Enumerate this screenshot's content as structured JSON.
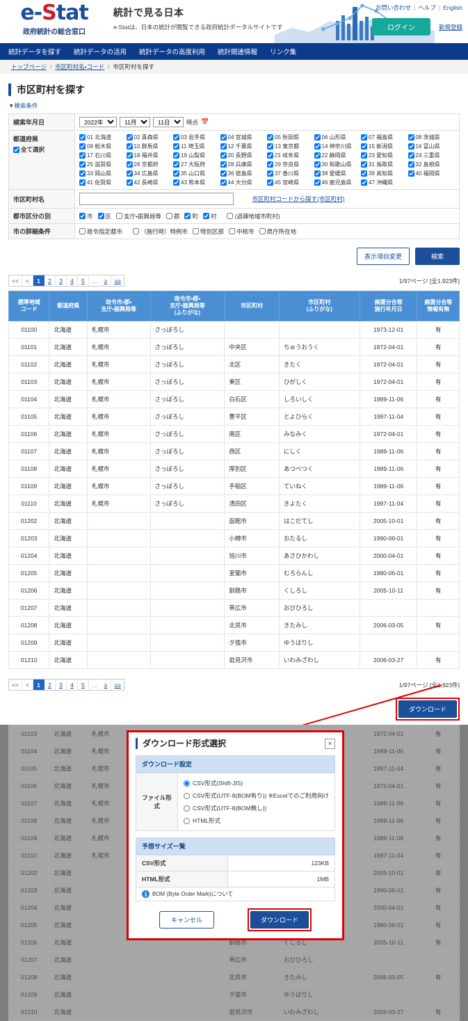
{
  "header": {
    "logo_text": "e-Stat",
    "logo_sub": "政府統計の総合窓口",
    "tagline_title": "統計で見る日本",
    "tagline_sub": "e-Statは、日本の統計が閲覧できる政府統計ポータルサイトです",
    "util_links": [
      "お問い合わせ",
      "ヘルプ",
      "English"
    ],
    "login_label": "ログイン",
    "register_label": "新規登録",
    "login_color": "#16a89a",
    "nav_color": "#0c3b8c"
  },
  "nav": {
    "items": [
      "統計データを探す",
      "統計データの活用",
      "統計データの高度利用",
      "統計関連情報",
      "リンク集"
    ]
  },
  "breadcrumb": {
    "items": [
      "トップページ",
      "市区町村名・コード",
      "市区町村を探す"
    ]
  },
  "page": {
    "title": "市区町村を探す",
    "cond_toggle": "▼検索条件"
  },
  "conditions": {
    "date_label": "検索年月日",
    "year": "2022年",
    "month": "11月",
    "day": "11日",
    "jiten": "時点",
    "calendar_icon": "calendar-icon",
    "pref_label": "都道府県",
    "select_all_label": "全て選択",
    "prefectures": [
      "01 北海道",
      "02 青森県",
      "03 岩手県",
      "04 宮城県",
      "05 秋田県",
      "06 山形県",
      "07 福島県",
      "08 茨城県",
      "09 栃木県",
      "10 群馬県",
      "11 埼玉県",
      "12 千葉県",
      "13 東京都",
      "14 神奈川県",
      "15 新潟県",
      "16 富山県",
      "17 石川県",
      "18 福井県",
      "19 山梨県",
      "20 長野県",
      "21 岐阜県",
      "22 静岡県",
      "23 愛知県",
      "24 三重県",
      "25 滋賀県",
      "26 京都府",
      "27 大阪府",
      "28 兵庫県",
      "29 奈良県",
      "30 和歌山県",
      "31 鳥取県",
      "32 島根県",
      "33 岡山県",
      "34 広島県",
      "35 山口県",
      "36 徳島県",
      "37 香川県",
      "38 愛媛県",
      "39 高知県",
      "40 福岡県",
      "41 佐賀県",
      "42 長崎県",
      "43 熊本県",
      "44 大分県",
      "45 宮崎県",
      "46 鹿児島県",
      "47 沖縄県"
    ],
    "city_name_label": "市区町村名",
    "city_name_value": "",
    "city_name_placeholder": "",
    "code_search_link": "市区町村コードから探す(市区町村)",
    "city_type_label": "都市区分の別",
    "city_types": [
      {
        "label": "市",
        "checked": true
      },
      {
        "label": "区",
        "checked": true
      },
      {
        "label": "支庁・振興局等",
        "checked": false
      },
      {
        "label": "郡",
        "checked": false
      },
      {
        "label": "町",
        "checked": true
      },
      {
        "label": "村",
        "checked": true
      },
      {
        "label": "(過疎地域市町村)",
        "checked": false
      }
    ],
    "city_detail_label": "市の詳細条件",
    "city_details": [
      {
        "label": "政令指定都市",
        "checked": false
      },
      {
        "label": "（施行時）特例市",
        "checked": false
      },
      {
        "label": "特別区部",
        "checked": false
      },
      {
        "label": "中核市",
        "checked": false
      },
      {
        "label": "県庁所在地",
        "checked": false
      }
    ]
  },
  "actions": {
    "display_change_label": "表示項目変更",
    "search_label": "検索"
  },
  "pagination": {
    "first": "<<",
    "prev": "<",
    "pages": [
      "1",
      "2",
      "3",
      "4",
      "5"
    ],
    "current": "1",
    "ellipsis": "…",
    "next": "≥",
    "last": "≥≥",
    "result_text": "1/97ページ [全1,923件]"
  },
  "results": {
    "columns": [
      "標準地域\nコード",
      "都道府県",
      "政令市・郡・\n支庁・振興局等",
      "政令市・郡・\n支庁・振興局等\n(ふりがな)",
      "市区町村",
      "市区町村\n(ふりがな)",
      "廃置分合等\n施行年月日",
      "廃置分合等\n情報有無"
    ],
    "rows": [
      [
        "01100",
        "北海道",
        "札幌市",
        "さっぽろし",
        "",
        "",
        "1973-12-01",
        "有"
      ],
      [
        "01101",
        "北海道",
        "札幌市",
        "さっぽろし",
        "中央区",
        "ちゅうおうく",
        "1972-04-01",
        "有"
      ],
      [
        "01102",
        "北海道",
        "札幌市",
        "さっぽろし",
        "北区",
        "きたく",
        "1972-04-01",
        "有"
      ],
      [
        "01103",
        "北海道",
        "札幌市",
        "さっぽろし",
        "東区",
        "ひがしく",
        "1972-04-01",
        "有"
      ],
      [
        "01104",
        "北海道",
        "札幌市",
        "さっぽろし",
        "白石区",
        "しろいしく",
        "1989-11-06",
        "有"
      ],
      [
        "01105",
        "北海道",
        "札幌市",
        "さっぽろし",
        "豊平区",
        "とよひらく",
        "1997-11-04",
        "有"
      ],
      [
        "01106",
        "北海道",
        "札幌市",
        "さっぽろし",
        "南区",
        "みなみく",
        "1972-04-01",
        "有"
      ],
      [
        "01107",
        "北海道",
        "札幌市",
        "さっぽろし",
        "西区",
        "にしく",
        "1989-11-06",
        "有"
      ],
      [
        "01108",
        "北海道",
        "札幌市",
        "さっぽろし",
        "厚別区",
        "あつべつく",
        "1989-11-06",
        "有"
      ],
      [
        "01109",
        "北海道",
        "札幌市",
        "さっぽろし",
        "手稲区",
        "ていねく",
        "1989-11-06",
        "有"
      ],
      [
        "01110",
        "北海道",
        "札幌市",
        "さっぽろし",
        "清田区",
        "きよたく",
        "1997-11-04",
        "有"
      ],
      [
        "01202",
        "北海道",
        "",
        "",
        "函館市",
        "はこだてし",
        "2005-10-01",
        "有"
      ],
      [
        "01203",
        "北海道",
        "",
        "",
        "小樽市",
        "おたるし",
        "1990-06-01",
        "有"
      ],
      [
        "01204",
        "北海道",
        "",
        "",
        "旭川市",
        "あさひかわし",
        "2000-04-01",
        "有"
      ],
      [
        "01205",
        "北海道",
        "",
        "",
        "室蘭市",
        "むろらんし",
        "1980-06-01",
        "有"
      ],
      [
        "01206",
        "北海道",
        "",
        "",
        "釧路市",
        "くしろし",
        "2005-10-11",
        "有"
      ],
      [
        "01207",
        "北海道",
        "",
        "",
        "帯広市",
        "おびひろし",
        "",
        ""
      ],
      [
        "01208",
        "北海道",
        "",
        "",
        "北見市",
        "きたみし",
        "2006-03-05",
        "有"
      ],
      [
        "01209",
        "北海道",
        "",
        "",
        "夕張市",
        "ゆうばりし",
        "",
        ""
      ],
      [
        "01210",
        "北海道",
        "",
        "",
        "岩見沢市",
        "いわみざわし",
        "2006-03-27",
        "有"
      ]
    ]
  },
  "download": {
    "button_label": "ダウンロード",
    "highlight_color": "#e00000"
  },
  "overlay_rows": [
    [
      "01103",
      "北海道",
      "札幌市",
      "さっぽろし",
      "東区",
      "ひがしく",
      "1972-04-01",
      "有"
    ],
    [
      "01104",
      "北海道",
      "札幌市",
      "さっぽろし",
      "白石区",
      "しろいしく",
      "1989-11-06",
      "有"
    ],
    [
      "01105",
      "北海道",
      "札幌市",
      "さっぽろし",
      "豊平区",
      "とよひらく",
      "1997-11-04",
      "有"
    ],
    [
      "01106",
      "北海道",
      "札幌市",
      "さっぽろし",
      "南区",
      "みなみく",
      "1972-04-01",
      "有"
    ],
    [
      "01107",
      "北海道",
      "札幌市",
      "さっぽろし",
      "西区",
      "にしく",
      "1989-11-06",
      "有"
    ],
    [
      "01108",
      "北海道",
      "札幌市",
      "さっぽろし",
      "厚別区",
      "あつべつく",
      "1989-11-06",
      "有"
    ],
    [
      "01109",
      "北海道",
      "札幌市",
      "さっぽろし",
      "手稲区",
      "ていねく",
      "1989-11-06",
      "有"
    ],
    [
      "01110",
      "北海道",
      "札幌市",
      "さっぽろし",
      "清田区",
      "きよたく",
      "1997-11-04",
      "有"
    ],
    [
      "01202",
      "北海道",
      "",
      "",
      "函館市",
      "はこだてし",
      "2005-10-01",
      "有"
    ],
    [
      "01203",
      "北海道",
      "",
      "",
      "小樽市",
      "おたるし",
      "1990-06-01",
      "有"
    ],
    [
      "01204",
      "北海道",
      "",
      "",
      "旭川市",
      "あさひかわし",
      "2000-04-01",
      "有"
    ],
    [
      "01205",
      "北海道",
      "",
      "",
      "室蘭市",
      "むろらんし",
      "1980-06-01",
      "有"
    ],
    [
      "01206",
      "北海道",
      "",
      "",
      "釧路市",
      "くしろし",
      "2005-10-11",
      "有"
    ],
    [
      "01207",
      "北海道",
      "",
      "",
      "帯広市",
      "おびひろし",
      "",
      ""
    ],
    [
      "01208",
      "北海道",
      "",
      "",
      "北見市",
      "きたみし",
      "2006-03-05",
      "有"
    ],
    [
      "01209",
      "北海道",
      "",
      "",
      "夕張市",
      "ゆうばりし",
      "",
      ""
    ],
    [
      "01210",
      "北海道",
      "",
      "",
      "岩見沢市",
      "いわみざわし",
      "2006-03-27",
      "有"
    ]
  ],
  "modal": {
    "title": "ダウンロード形式選択",
    "close_label": "×",
    "settings_head": "ダウンロード設定",
    "file_format_label": "ファイル形式",
    "formats": [
      {
        "label": "CSV形式(Shift-JIS)",
        "selected": true
      },
      {
        "label": "CSV形式(UTF-8(BOM有り)) ※Excelでのご利用向け",
        "selected": false
      },
      {
        "label": "CSV形式(UTF-8(BOM無し))",
        "selected": false
      },
      {
        "label": "HTML形式",
        "selected": false
      }
    ],
    "size_head": "予想サイズ一覧",
    "sizes": [
      {
        "label": "CSV形式",
        "value": "123KB"
      },
      {
        "label": "HTML形式",
        "value": "1MB"
      }
    ],
    "bom_note": "BOM (Byte Order Mark)について",
    "cancel_label": "キャンセル",
    "download_label": "ダウンロード"
  }
}
